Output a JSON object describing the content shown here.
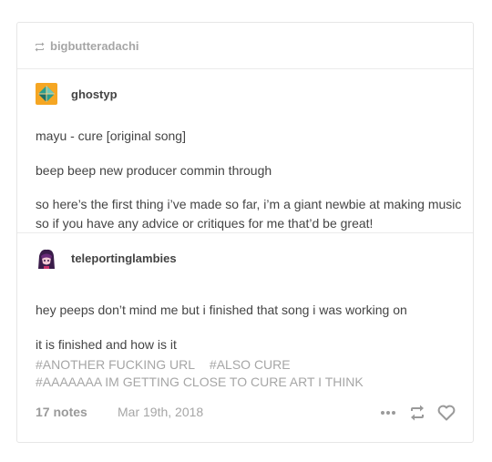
{
  "reblog": {
    "username": "bigbutteradachi",
    "icon": "reblog-icon"
  },
  "posts": [
    {
      "author": "ghostyp",
      "avatar_icon": "diamond-avatar",
      "paragraphs": [
        "mayu - cure [original song]",
        "beep beep new producer commin through",
        "so here’s the first thing i’ve made so far, i’m a giant newbie at making music so if you have any advice or critiques for me that’d be great!"
      ]
    },
    {
      "author": "teleportinglambies",
      "avatar_icon": "character-avatar",
      "paragraphs": [
        "hey peeps don’t mind me but i finished that song i was working on",
        "it is finished and how is it"
      ]
    }
  ],
  "tags": [
    "#ANOTHER FUCKING URL",
    "#ALSO CURE",
    "#AAAAAAA IM GETTING CLOSE TO CURE ART I THINK"
  ],
  "footer": {
    "notes": "17 notes",
    "date": "Mar 19th, 2018",
    "icons": [
      "more-icon",
      "reblog-icon",
      "heart-icon"
    ]
  },
  "colors": {
    "text": "#444444",
    "muted": "#a6a6a6",
    "border": "#e6e6e6",
    "avatar_orange": "#f5a623",
    "avatar_teal": "#2a9d8f"
  }
}
